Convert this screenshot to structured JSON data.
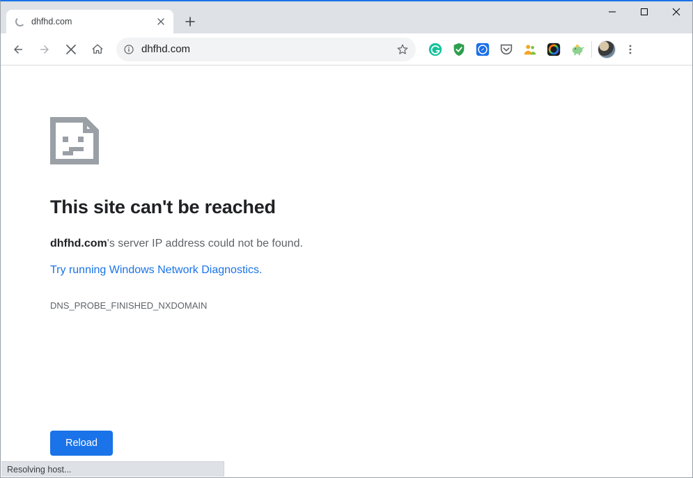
{
  "window": {
    "tab_title": "dhfhd.com"
  },
  "toolbar": {
    "url": "dhfhd.com"
  },
  "extensions": [
    {
      "name": "grammarly-icon"
    },
    {
      "name": "adguard-icon"
    },
    {
      "name": "safari-ext-icon"
    },
    {
      "name": "pocket-icon"
    },
    {
      "name": "people-ext-icon"
    },
    {
      "name": "color-ring-icon"
    },
    {
      "name": "piggy-ext-icon"
    }
  ],
  "error": {
    "title": "This site can't be reached",
    "domain": "dhfhd.com",
    "message_suffix": "'s server IP address could not be found.",
    "diagnostics_link": "Try running Windows Network Diagnostics",
    "diagnostics_period": ".",
    "code": "DNS_PROBE_FINISHED_NXDOMAIN",
    "reload_label": "Reload"
  },
  "status": {
    "text": "Resolving host..."
  }
}
